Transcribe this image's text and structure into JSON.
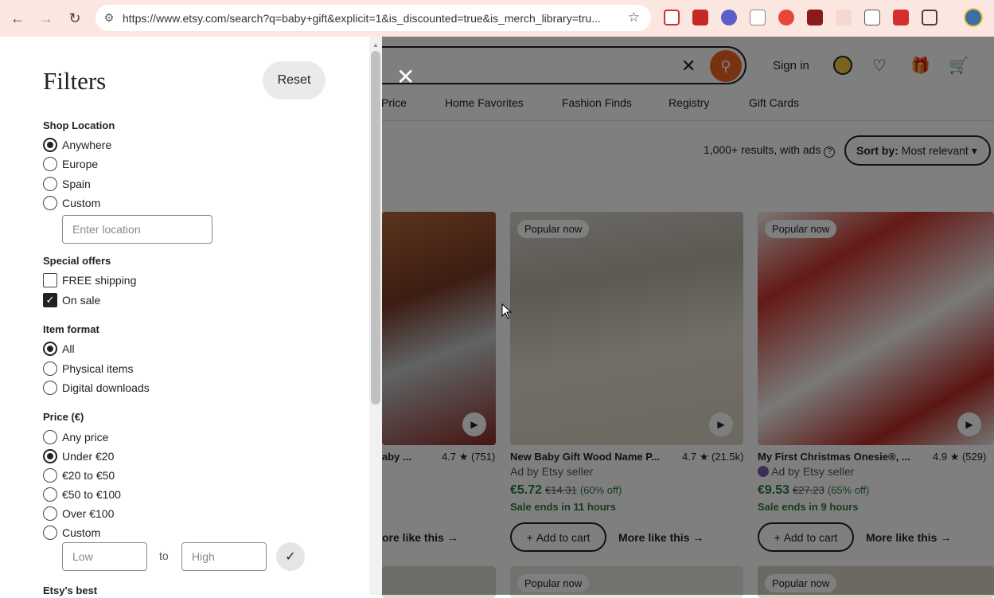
{
  "browser": {
    "url": "https://www.etsy.com/search?q=baby+gift&explicit=1&is_discounted=true&is_merch_library=tru...",
    "icons": [
      "back-icon",
      "forward-icon",
      "reload-icon",
      "site-info-icon",
      "bookmark-star-icon"
    ]
  },
  "header": {
    "sign_in": "Sign in",
    "categories": [
      "Price",
      "Home Favorites",
      "Fashion Finds",
      "Registry",
      "Gift Cards"
    ]
  },
  "results": {
    "summary": "1,000+ results, with ads",
    "sort_label": "Sort by:",
    "sort_value": "Most relevant"
  },
  "products": [
    {
      "title": "aby ...",
      "rating": "4.7",
      "reviews": "(751)",
      "more": "ore like this"
    },
    {
      "badge": "Popular now",
      "title": "New Baby Gift Wood Name P...",
      "rating": "4.7",
      "reviews": "(21.5k)",
      "seller": "Ad by Etsy seller",
      "price": "€5.72",
      "old_price": "€14.31",
      "discount": "(60% off)",
      "sale": "Sale ends in 11 hours",
      "cart": "Add to cart",
      "more": "More like this"
    },
    {
      "badge": "Popular now",
      "title": "My First Christmas Onesie®, ...",
      "rating": "4.9",
      "reviews": "(529)",
      "seller": "Ad by Etsy seller",
      "price": "€9.53",
      "old_price": "€27.23",
      "discount": "(65% off)",
      "sale": "Sale ends in 9 hours",
      "cart": "Add to cart",
      "more": "More like this"
    }
  ],
  "bottom_badges": [
    "Popular now",
    "Popular now"
  ],
  "filters": {
    "title": "Filters",
    "reset": "Reset",
    "shop_location": {
      "label": "Shop Location",
      "options": [
        "Anywhere",
        "Europe",
        "Spain",
        "Custom"
      ],
      "selected": "Anywhere",
      "placeholder": "Enter location"
    },
    "special_offers": {
      "label": "Special offers",
      "options": [
        "FREE shipping",
        "On sale"
      ],
      "checked": "On sale"
    },
    "item_format": {
      "label": "Item format",
      "options": [
        "All",
        "Physical items",
        "Digital downloads"
      ],
      "selected": "All"
    },
    "price": {
      "label": "Price (€)",
      "options": [
        "Any price",
        "Under €20",
        "€20 to €50",
        "€50 to €100",
        "Over €100",
        "Custom"
      ],
      "selected": "Under €20",
      "low_placeholder": "Low",
      "to": "to",
      "high_placeholder": "High"
    },
    "next_section": "Etsy's best"
  }
}
